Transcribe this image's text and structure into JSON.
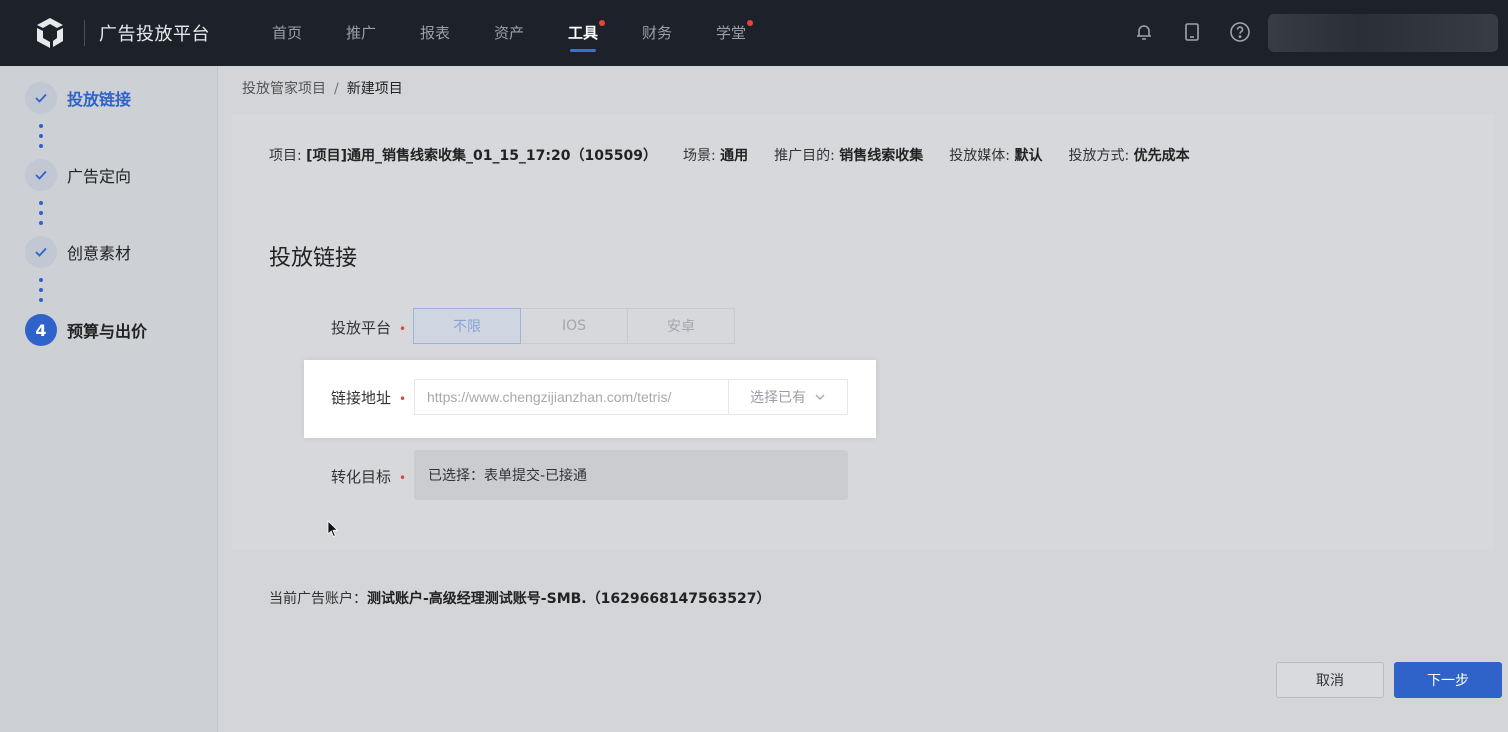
{
  "header": {
    "brand": "广告投放平台",
    "nav": [
      {
        "label": "首页",
        "dot": false
      },
      {
        "label": "推广",
        "dot": false
      },
      {
        "label": "报表",
        "dot": false
      },
      {
        "label": "资产",
        "dot": false
      },
      {
        "label": "工具",
        "dot": true,
        "active": true
      },
      {
        "label": "财务",
        "dot": false
      },
      {
        "label": "学堂",
        "dot": true
      }
    ],
    "icons": [
      "bell-icon",
      "tablet-icon",
      "help-icon"
    ]
  },
  "steps": [
    {
      "label": "投放链接",
      "status": "done",
      "active": true
    },
    {
      "label": "广告定向",
      "status": "done"
    },
    {
      "label": "创意素材",
      "status": "done"
    },
    {
      "label": "预算与出价",
      "status": "current",
      "number": "4"
    }
  ],
  "breadcrumb": {
    "parent": "投放管家项目",
    "separator": "/",
    "current": "新建项目"
  },
  "project_info": {
    "project_label": "项目:",
    "project_value": "[项目]通用_销售线索收集_01_15_17:20（105509）",
    "scene_label": "场景:",
    "scene_value": "通用",
    "purpose_label": "推广目的:",
    "purpose_value": "销售线索收集",
    "media_label": "投放媒体:",
    "media_value": "默认",
    "method_label": "投放方式:",
    "method_value": "优先成本"
  },
  "section_title": "投放链接",
  "form": {
    "platform_label": "投放平台",
    "platform_options": [
      "不限",
      "IOS",
      "安卓"
    ],
    "platform_selected": "不限",
    "url_label": "链接地址",
    "url_value": "https://www.chengzijianzhan.com/tetris/",
    "url_select": "选择已有",
    "target_label": "转化目标",
    "target_value": "已选择：表单提交-已接通"
  },
  "account": {
    "label": "当前广告账户：",
    "value": "测试账户-高级经理测试账号-SMB.（1629668147563527）"
  },
  "buttons": {
    "cancel": "取消",
    "next": "下一步"
  },
  "colors": {
    "accent": "#2f63c9",
    "nav_bg": "#1d2129",
    "required": "#d9463c"
  }
}
